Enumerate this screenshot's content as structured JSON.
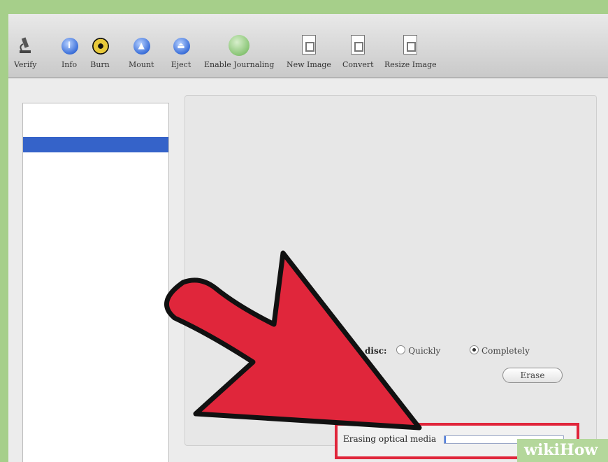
{
  "toolbar": {
    "items": [
      {
        "label": "Verify",
        "icon": "microscope-icon"
      },
      {
        "label": "Info",
        "icon": "info-icon"
      },
      {
        "label": "Burn",
        "icon": "burn-icon"
      },
      {
        "label": "Mount",
        "icon": "mount-icon"
      },
      {
        "label": "Eject",
        "icon": "eject-icon"
      },
      {
        "label": "Enable Journaling",
        "icon": "journaling-icon"
      },
      {
        "label": "New Image",
        "icon": "new-image-icon"
      },
      {
        "label": "Convert",
        "icon": "convert-icon"
      },
      {
        "label": "Resize Image",
        "icon": "resize-image-icon"
      }
    ]
  },
  "erase": {
    "label": "disc:",
    "option_quickly": "Quickly",
    "option_completely": "Completely",
    "selected": "Completely",
    "button": "Erase"
  },
  "status": {
    "text": "Erasing optical media",
    "progress": 0.01
  },
  "watermark": {
    "wiki": "wiki",
    "how": "How"
  },
  "colors": {
    "highlight_box": "#e0263b",
    "arrow": "#e0263b",
    "selection": "#3563c9"
  }
}
